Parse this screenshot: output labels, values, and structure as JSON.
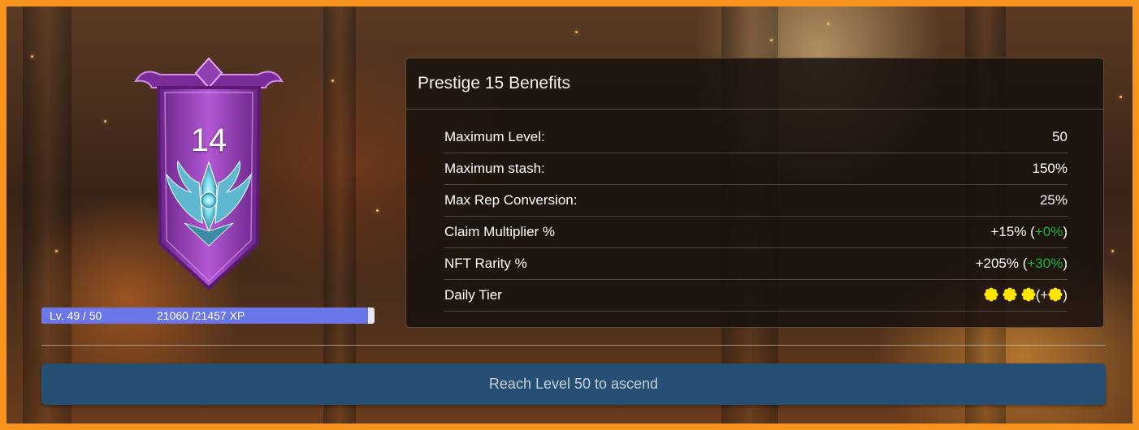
{
  "emblem": {
    "prestige_level": "14",
    "icon": "winged-crest-banner"
  },
  "xp": {
    "level_label": "Lv. 49 / 50",
    "xp_label": "21060 /21457 XP",
    "current": 21060,
    "required": 21457,
    "progress_fraction": 0.981
  },
  "benefits": {
    "title": "Prestige 15 Benefits",
    "rows": [
      {
        "label": "Maximum Level:",
        "value": "50",
        "bonus": ""
      },
      {
        "label": "Maximum stash:",
        "value": "150%",
        "bonus": ""
      },
      {
        "label": "Max Rep Conversion:",
        "value": "25%",
        "bonus": ""
      },
      {
        "label": "Claim Multiplier %",
        "value": "+15% (",
        "bonus": "+0%",
        "suffix": ")"
      },
      {
        "label": "NFT Rarity %",
        "value": "+205% (",
        "bonus": "+30%",
        "suffix": ")"
      },
      {
        "label": "Daily Tier",
        "value_open": "(+",
        "value_close": ")",
        "stars": 3,
        "bonus_stars": 1
      }
    ]
  },
  "ascend_button": {
    "label": "Reach Level 50 to ascend"
  },
  "colors": {
    "frame": "#f7941d",
    "xp_fill": "#6b77e8",
    "bonus_green": "#22b43c",
    "star_yellow": "#ffe600",
    "button": "#264f74",
    "banner_purple": "#9b3fb8"
  }
}
